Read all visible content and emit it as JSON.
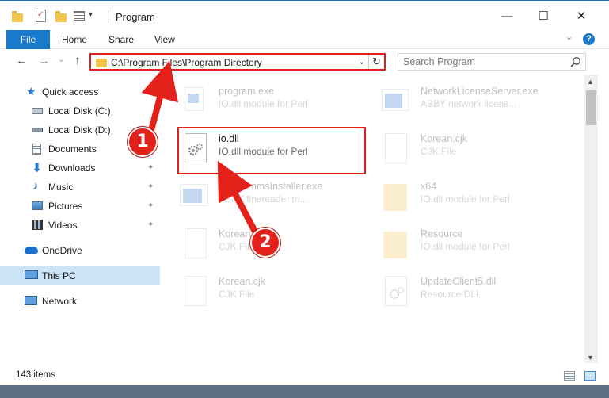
{
  "window": {
    "title": "Program",
    "minimize_glyph": "—",
    "maximize_glyph": "☐",
    "close_glyph": "✕"
  },
  "ribbon": {
    "file_tab": "File",
    "tabs": [
      "Home",
      "Share",
      "View"
    ],
    "help_glyph": "?",
    "expand_glyph": "⌄"
  },
  "nav": {
    "back_glyph": "←",
    "forward_glyph": "→",
    "recent_glyph": "⌄",
    "up_glyph": "↑",
    "address": "C:\\Program Files\\Program Directory",
    "dropdown_glyph": "⌄",
    "refresh_glyph": "↻",
    "search_placeholder": "Search Program"
  },
  "sidebar": {
    "items": [
      {
        "label": "Quick access",
        "icon": "star-icon"
      },
      {
        "label": "Local Disk (C:)",
        "icon": "drive-icon"
      },
      {
        "label": "Local Disk (D:)",
        "icon": "drive-icon"
      },
      {
        "label": "Documents",
        "icon": "documents-icon",
        "pinned": true
      },
      {
        "label": "Downloads",
        "icon": "download-icon",
        "pinned": true
      },
      {
        "label": "Music",
        "icon": "music-icon",
        "pinned": true
      },
      {
        "label": "Pictures",
        "icon": "pictures-icon",
        "pinned": true
      },
      {
        "label": "Videos",
        "icon": "videos-icon",
        "pinned": true
      },
      {
        "label": "OneDrive",
        "icon": "cloud-icon"
      },
      {
        "label": "This PC",
        "icon": "computer-icon",
        "selected": true
      },
      {
        "label": "Network",
        "icon": "network-icon"
      }
    ],
    "pin_glyph": "📌"
  },
  "files": [
    {
      "name": "program.exe",
      "desc": "IO.dll module for Perl",
      "icon": "exe-icon"
    },
    {
      "name": "NetworkLicenseServer.exe",
      "desc": "ABBY network licens...",
      "icon": "app-icon"
    },
    {
      "name": "io.dll",
      "desc": "IO.dll module for Perl",
      "icon": "dll-gear-icon"
    },
    {
      "name": "Korean.cjk",
      "desc": "CJK File",
      "icon": "blank-file-icon"
    },
    {
      "name": "ProgrammsInstaller.exe",
      "desc": "ABBY finereader tri...",
      "icon": "app-icon"
    },
    {
      "name": "x64",
      "desc": "IO.dll module for Perl",
      "icon": "folder-icon"
    },
    {
      "name": "Korean.cjk",
      "desc": "CJK File",
      "icon": "blank-file-icon"
    },
    {
      "name": "Resource",
      "desc": "IO.dll module for Perl",
      "icon": "folder-icon"
    },
    {
      "name": "Korean.cjk",
      "desc": "CJK File",
      "icon": "blank-file-icon"
    },
    {
      "name": "UpdateClient5.dll",
      "desc": "Resource DLL",
      "icon": "dll-gear-icon"
    }
  ],
  "status": {
    "item_count": "143 items"
  },
  "annotations": {
    "step1": "1",
    "step2": "2"
  },
  "colors": {
    "accent": "#1979ca",
    "highlight_red": "#e0201c",
    "selected_bg": "#cce4f7"
  }
}
